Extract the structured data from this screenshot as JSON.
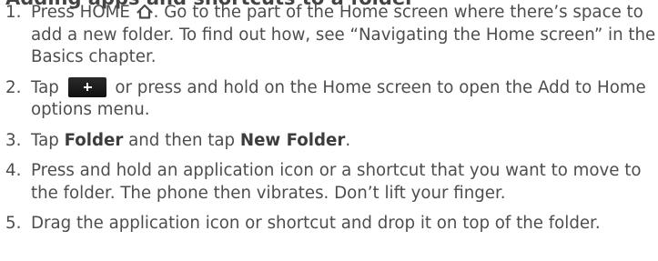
{
  "heading": "Adding apps and shortcuts to a folder",
  "steps": [
    {
      "number": "1.",
      "part1": "Press HOME",
      "icon": "home-icon",
      "part2": ". Go to the part of the Home screen where there’s space to add a new folder. To find out how, see “Navigating the Home screen” in the Basics chapter."
    },
    {
      "number": "2.",
      "part1": "Tap",
      "icon": "add-icon",
      "part2": "or press and hold on the Home screen to open the Add to Home options menu."
    },
    {
      "number": "3.",
      "part1": "Tap ",
      "bold1": "Folder",
      "part2": " and then tap ",
      "bold2": "New Folder",
      "part3": "."
    },
    {
      "number": "4.",
      "text": "Press and hold an application icon or a shortcut that you want to move to the folder. The phone then vibrates. Don’t lift your finger."
    },
    {
      "number": "5.",
      "text": "Drag the application icon or shortcut and drop it on top of the folder."
    }
  ]
}
